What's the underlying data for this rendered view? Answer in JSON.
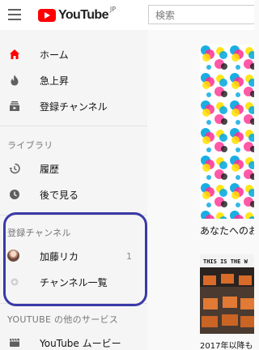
{
  "header": {
    "logo_text": "YouTube",
    "region": "JP",
    "search_placeholder": "検索"
  },
  "sidebar": {
    "main_items": [
      {
        "label": "ホーム",
        "icon": "home-icon",
        "active": true
      },
      {
        "label": "急上昇",
        "icon": "flame-icon"
      },
      {
        "label": "登録チャンネル",
        "icon": "subscriptions-icon"
      }
    ],
    "library_title": "ライブラリ",
    "library_items": [
      {
        "label": "履歴",
        "icon": "history-icon"
      },
      {
        "label": "後で見る",
        "icon": "watch-later-icon"
      }
    ],
    "subscriptions_title": "登録チャンネル",
    "subscriptions": [
      {
        "label": "加藤リカ",
        "count": "1"
      },
      {
        "label": "チャンネル一覧"
      }
    ],
    "more_title": "YOUTUBE の他のサービス",
    "more_items": [
      {
        "label": "YouTube ムービー",
        "icon": "movies-icon"
      }
    ]
  },
  "main": {
    "section_heading": "あなたへのおすすめ",
    "thumbnail_text": "THIS IS THE W",
    "video_title": "2017年以降も"
  },
  "colors": {
    "accent": "#ff0000",
    "highlight_ring": "#3a3aa8"
  }
}
